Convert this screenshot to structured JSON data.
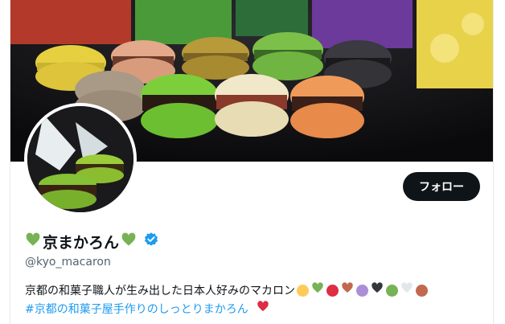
{
  "profile": {
    "display_name": "京まかろん",
    "handle": "@kyo_macaron",
    "verified": true,
    "follow_label": "フォロー",
    "name_emoji": "green-heart-icon",
    "bio": {
      "line1_text": "京都の和菓子職人が生み出した日本人好みのマカロン",
      "line1_emojis": [
        "yellow-heart-icon",
        "green-heart-icon",
        "red-heart-icon",
        "brown-heart-icon",
        "purple-heart-icon",
        "black-heart-icon",
        "green-heart-icon",
        "white-heart-icon",
        "brown-heart-icon"
      ],
      "hashtag": "#京都の和菓子屋手作りのしっとりまかろん",
      "line2_emoji": "red-heart-icon"
    }
  },
  "colors": {
    "green_heart": "#77b255",
    "yellow_heart": "#fdcb58",
    "red_heart": "#dd2e44",
    "brown_heart": "#c1694f",
    "purple_heart": "#aa8ed6",
    "black_heart": "#31373d",
    "white_heart": "#e1e8ed",
    "verified_blue": "#1d9bf0",
    "hashtag_blue": "#1d9bf0",
    "follow_bg": "#0f1419"
  }
}
